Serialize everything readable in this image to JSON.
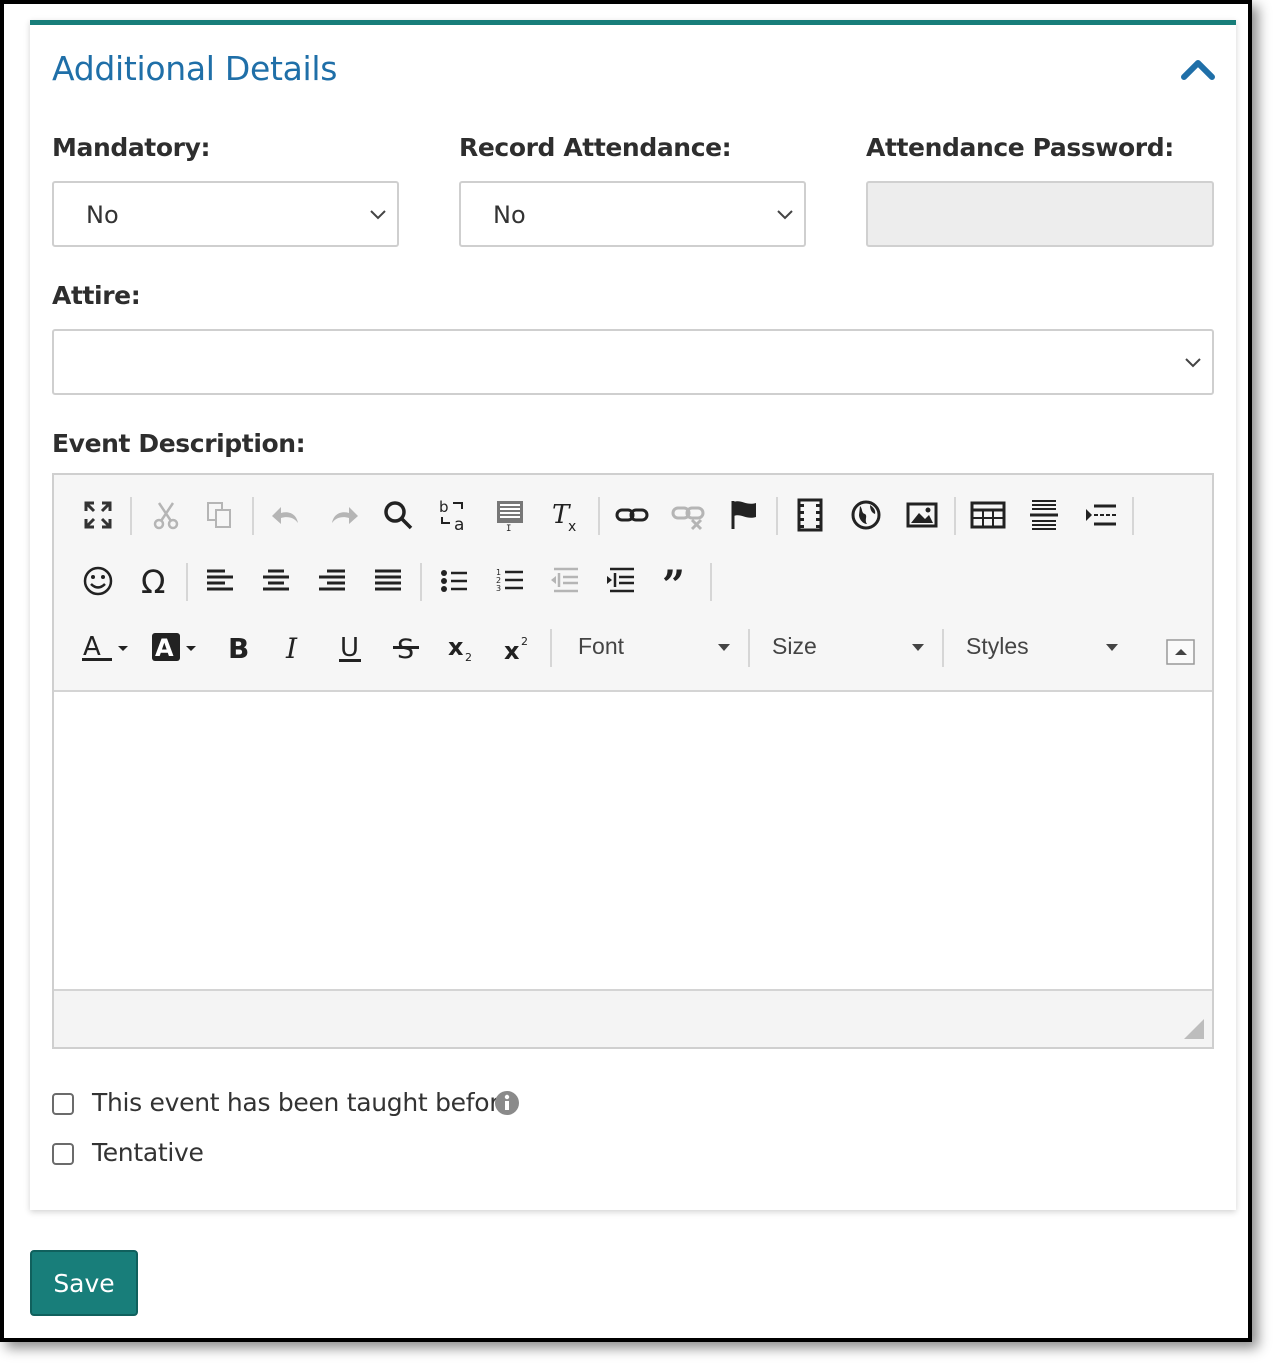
{
  "panel": {
    "title": "Additional Details",
    "accent_color": "#187e7a",
    "title_color": "#1f6fa8",
    "collapse_icon": "chevron-up-icon"
  },
  "fields": {
    "mandatory": {
      "label": "Mandatory:",
      "value": "No"
    },
    "record_attendance": {
      "label": "Record Attendance:",
      "value": "No"
    },
    "attendance_password": {
      "label": "Attendance Password:",
      "value": ""
    },
    "attire": {
      "label": "Attire:",
      "value": ""
    },
    "event_description": {
      "label": "Event Description:"
    }
  },
  "editor": {
    "toolbar_row1_icons": [
      "maximize-icon",
      "cut-icon",
      "copy-icon",
      "undo-icon",
      "redo-icon",
      "find-icon",
      "replace-icon",
      "select-all-icon",
      "remove-format-icon",
      "link-icon",
      "unlink-icon",
      "anchor-icon",
      "video-icon",
      "globe-icon",
      "image-icon",
      "table-icon",
      "horizontal-rule-icon",
      "page-break-icon"
    ],
    "toolbar_row2_icons": [
      "smiley-icon",
      "special-char-icon",
      "align-left-icon",
      "align-center-icon",
      "align-right-icon",
      "justify-icon",
      "bulleted-list-icon",
      "numbered-list-icon",
      "outdent-icon",
      "indent-icon",
      "blockquote-icon"
    ],
    "toolbar_row3_icons": [
      "text-color-icon",
      "background-color-icon",
      "bold-icon",
      "italic-icon",
      "underline-icon",
      "strikethrough-icon",
      "subscript-icon",
      "superscript-icon"
    ],
    "font_label": "Font",
    "size_label": "Size",
    "styles_label": "Styles",
    "content": ""
  },
  "options": {
    "taught_before": {
      "label": "This event has been taught before",
      "checked": false
    },
    "tentative": {
      "label": "Tentative",
      "checked": false
    }
  },
  "actions": {
    "save_label": "Save",
    "save_color": "#187e7a"
  }
}
